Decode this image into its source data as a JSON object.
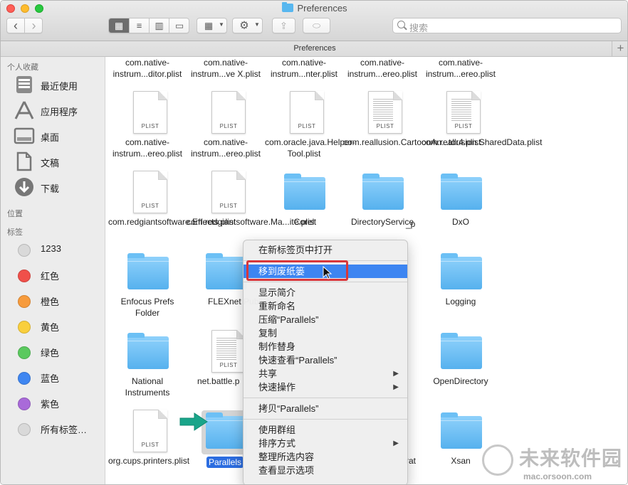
{
  "window": {
    "title": "Preferences",
    "path_title": "Preferences"
  },
  "toolbar": {
    "back": "‹",
    "forward": "›",
    "view_icon": "▦",
    "list_icon": "≡",
    "column_icon": "▥",
    "gallery_icon": "▭",
    "group_icon": "▦",
    "action_icon": "⚙",
    "share_icon": "⇪",
    "tag_icon": "⬭",
    "search_placeholder": "搜索"
  },
  "sidebar": {
    "favorites_header": "个人收藏",
    "favorites": [
      "最近使用",
      "应用程序",
      "桌面",
      "文稿",
      "下载"
    ],
    "locations_header": "位置",
    "tags_header": "标签",
    "tags": [
      {
        "label": "1233",
        "color": "#d9d9d9"
      },
      {
        "label": "红色",
        "color": "#f0504a"
      },
      {
        "label": "橙色",
        "color": "#f79b3c"
      },
      {
        "label": "黄色",
        "color": "#f9cf3d"
      },
      {
        "label": "绿色",
        "color": "#5ac95e"
      },
      {
        "label": "蓝色",
        "color": "#3f86f1"
      },
      {
        "label": "紫色",
        "color": "#a96ad9"
      },
      {
        "label": "所有标签…",
        "color": "#d9d9d9"
      }
    ]
  },
  "files": [
    {
      "name": "com.native-instrum...ditor.plist",
      "kind": "hidden"
    },
    {
      "name": "com.native-instrum...ve X.plist",
      "kind": "hidden"
    },
    {
      "name": "com.native-instrum...nter.plist",
      "kind": "hidden"
    },
    {
      "name": "com.native-instrum...ereo.plist",
      "kind": "hidden"
    },
    {
      "name": "com.native-instrum...ereo.plist",
      "kind": "hidden"
    },
    {
      "name": "com.native-instrum...ereo.plist",
      "kind": "plist"
    },
    {
      "name": "com.native-instrum...ereo.plist",
      "kind": "plist"
    },
    {
      "name": "com.oracle.java.Helper-Tool.plist",
      "kind": "plist"
    },
    {
      "name": "com.reallusion.CartoonAn...tor4.plist",
      "kind": "plistdoc"
    },
    {
      "name": "com.reallusion.SharedData.plist",
      "kind": "plistdoc"
    },
    {
      "name": "com.redgiantsoftware.Effects.plist",
      "kind": "plist"
    },
    {
      "name": "com.redgiantsoftware.Ma...ite.plist",
      "kind": "plist"
    },
    {
      "name": "Corel",
      "kind": "folder"
    },
    {
      "name": "DirectoryService",
      "kind": "folder"
    },
    {
      "name": "DxO",
      "kind": "folder"
    },
    {
      "name": "Enfocus Prefs Folder",
      "kind": "folder"
    },
    {
      "name": "FLEXnet Publisher",
      "kind": "folder"
    },
    {
      "name": "",
      "kind": "none"
    },
    {
      "name": "_p",
      "kind": "none"
    },
    {
      "name": "Logging",
      "kind": "folder"
    },
    {
      "name": "National Instruments",
      "kind": "folder"
    },
    {
      "name": "net.battle.p",
      "kind": "plistdoc"
    },
    {
      "name": "",
      "kind": "none"
    },
    {
      "name": "",
      "kind": "none"
    },
    {
      "name": "OpenDirectory",
      "kind": "folder"
    },
    {
      "name": "org.cups.printers.plist",
      "kind": "plist"
    },
    {
      "name": "Parallels",
      "kind": "folder"
    },
    {
      "name": "",
      "kind": "none"
    },
    {
      "name": "rat",
      "kind": "none"
    },
    {
      "name": "Xsan",
      "kind": "folder"
    }
  ],
  "plist_label": "PLIST",
  "selected_label": "Parallels",
  "context_menu": [
    {
      "label": "在新标签页中打开"
    },
    {
      "sep": true
    },
    {
      "label": "移到废纸篓",
      "highlight": true
    },
    {
      "sep": true
    },
    {
      "label": "显示简介"
    },
    {
      "label": "重新命名"
    },
    {
      "label": "压缩“Parallels”"
    },
    {
      "label": "复制"
    },
    {
      "label": "制作替身"
    },
    {
      "label": "快速查看“Parallels”"
    },
    {
      "label": "共享",
      "submenu": true
    },
    {
      "label": "快速操作",
      "submenu": true
    },
    {
      "sep": true
    },
    {
      "label": "拷贝“Parallels”"
    },
    {
      "sep": true
    },
    {
      "label": "使用群组"
    },
    {
      "label": "排序方式",
      "submenu": true
    },
    {
      "label": "整理所选内容"
    },
    {
      "label": "查看显示选项"
    }
  ],
  "submenu_arrow": "▶",
  "watermark": {
    "title": "未来软件园",
    "url": "mac.orsoon.com"
  }
}
